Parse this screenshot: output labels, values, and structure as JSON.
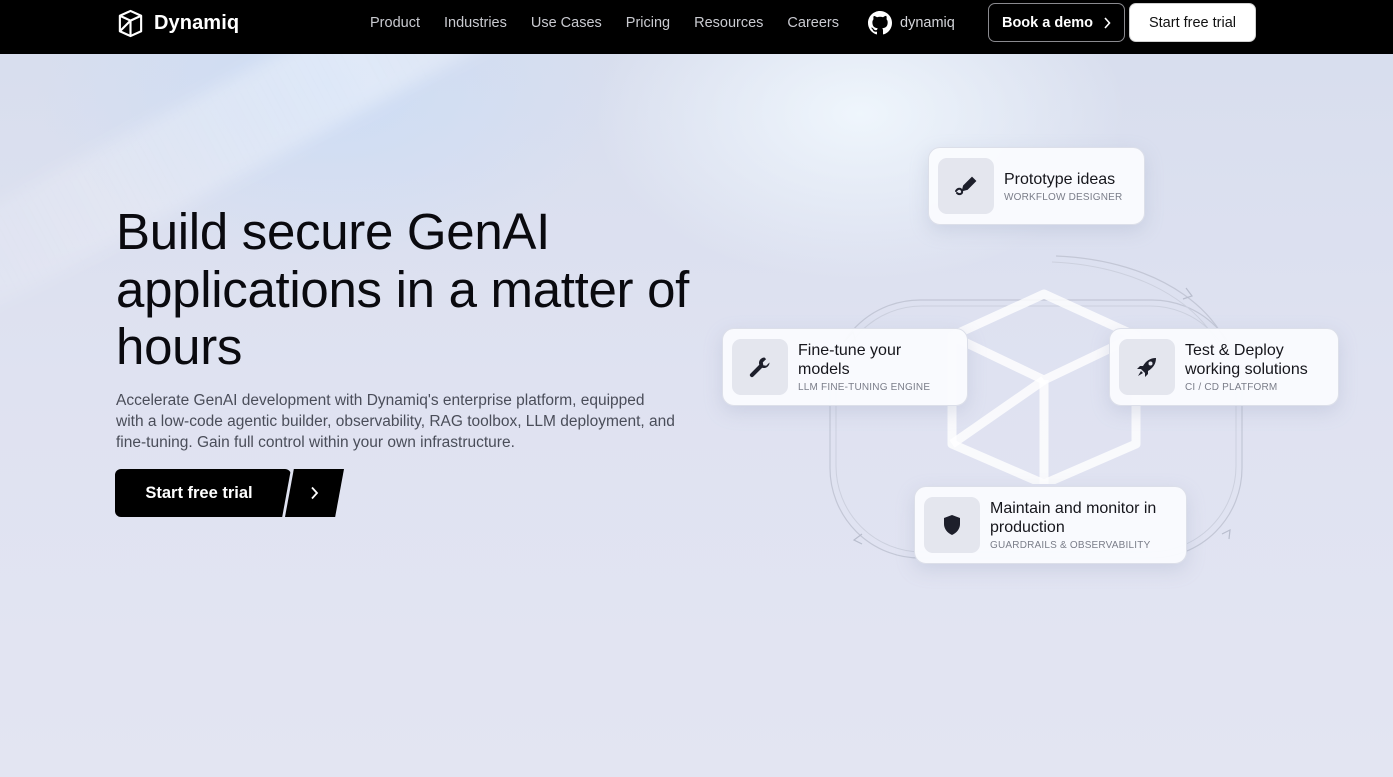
{
  "brand": {
    "name": "Dynamiq"
  },
  "nav": {
    "links": [
      {
        "label": "Product"
      },
      {
        "label": "Industries"
      },
      {
        "label": "Use Cases"
      },
      {
        "label": "Pricing"
      },
      {
        "label": "Resources"
      },
      {
        "label": "Careers"
      }
    ],
    "github_label": "dynamiq",
    "demo_button": "Book a demo",
    "trial_button": "Start free trial"
  },
  "hero": {
    "headline": "Build secure GenAI applications in a matter of hours",
    "subtext": "Accelerate GenAI development with Dynamiq's enterprise platform, equipped with a low-code agentic builder, observability, RAG toolbox, LLM deployment, and fine-tuning. Gain full control within your own infrastructure.",
    "cta_label": "Start free trial"
  },
  "cards": {
    "prototype": {
      "title": "Prototype ideas",
      "subtitle": "WORKFLOW DESIGNER",
      "icon": "pen-link-icon"
    },
    "finetune": {
      "title": "Fine-tune your models",
      "subtitle": "LLM FINE-TUNING ENGINE",
      "icon": "wrench-icon"
    },
    "deploy": {
      "title": "Test & Deploy working solutions",
      "subtitle": "CI / CD PLATFORM",
      "icon": "rocket-icon"
    },
    "monitor": {
      "title": "Maintain and monitor in production",
      "subtitle": "GUARDRAILS & OBSERVABILITY",
      "icon": "shield-icon"
    }
  },
  "colors": {
    "nav_background": "#000000",
    "hero_background": "#dfe2f1",
    "primary_button": "#000000",
    "icon_tile": "#e4e6ee"
  }
}
